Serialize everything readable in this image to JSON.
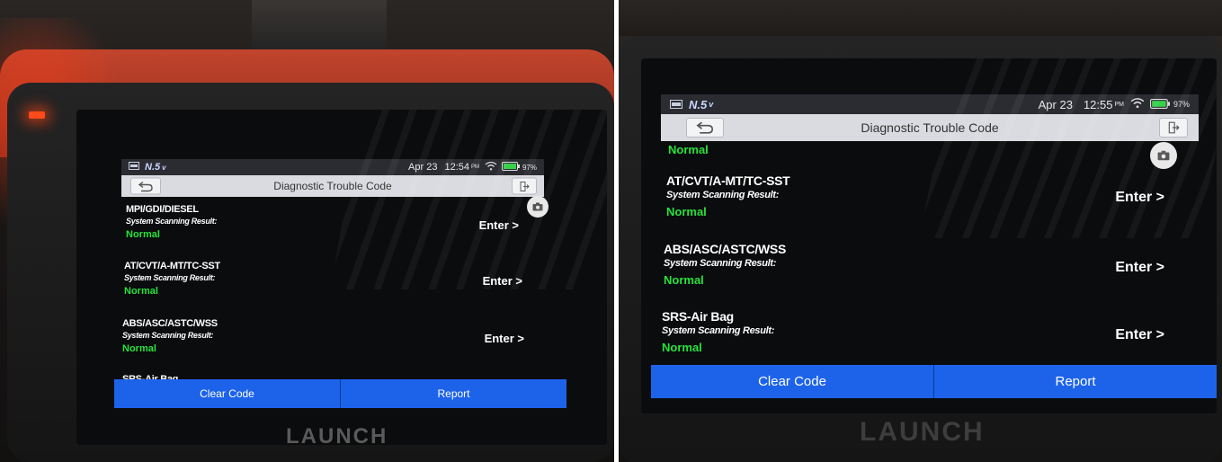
{
  "left": {
    "status_bar": {
      "brand": "N.5",
      "date": "Apr 23",
      "time": "12:54",
      "ampm": "PM",
      "battery": "97%"
    },
    "title": "Diagnostic Trouble Code",
    "items": [
      {
        "name": "MPI/GDI/DIESEL",
        "sub": "System Scanning Result:",
        "status": "Normal",
        "enter": "Enter >"
      },
      {
        "name": "AT/CVT/A-MT/TC-SST",
        "sub": "System Scanning Result:",
        "status": "Normal",
        "enter": "Enter >"
      },
      {
        "name": "ABS/ASC/ASTC/WSS",
        "sub": "System Scanning Result:",
        "status": "Normal",
        "enter": "Enter >"
      },
      {
        "name": "SRS-Air Bag"
      }
    ],
    "buttons": {
      "clear": "Clear Code",
      "report": "Report"
    },
    "device_brand": "LAUNCH"
  },
  "right": {
    "status_bar": {
      "brand": "N.5",
      "date": "Apr 23",
      "time": "12:55",
      "ampm": "PM",
      "battery": "97%"
    },
    "title": "Diagnostic Trouble Code",
    "partial_status": "Normal",
    "items": [
      {
        "name": "AT/CVT/A-MT/TC-SST",
        "sub": "System Scanning Result:",
        "status": "Normal",
        "enter": "Enter >"
      },
      {
        "name": "ABS/ASC/ASTC/WSS",
        "sub": "System Scanning Result:",
        "status": "Normal",
        "enter": "Enter >"
      },
      {
        "name": "SRS-Air Bag",
        "sub": "System Scanning Result:",
        "status": "Normal",
        "enter": "Enter >"
      }
    ],
    "buttons": {
      "clear": "Clear Code",
      "report": "Report"
    },
    "device_brand": "LAUNCH"
  },
  "icons": {
    "back": "back-arrow-icon",
    "exit": "exit-icon",
    "camera": "camera-icon",
    "wifi": "wifi-icon",
    "battery": "battery-icon",
    "vehicle": "vehicle-icon"
  },
  "colors": {
    "normal_status": "#27e23a",
    "action_button": "#1d63ea",
    "device_rubber": "#b33a25"
  }
}
